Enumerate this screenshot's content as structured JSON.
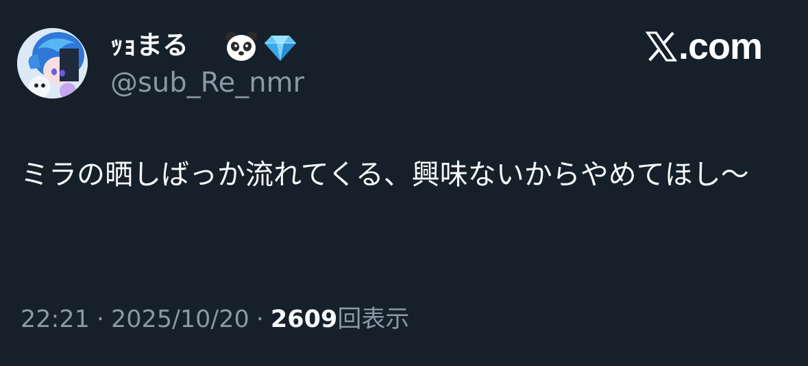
{
  "user": {
    "display_name": "ｯｮまる",
    "emojis": [
      "panda-icon",
      "gem-icon"
    ],
    "handle": "@sub_Re_nmr",
    "avatar": "anime-character-avatar"
  },
  "brand": {
    "logo": "x-logo-icon",
    "domain_text": ".com"
  },
  "tweet": {
    "text": "ミラの晒しばっか流れてくる、興味ないからやめてほし〜"
  },
  "meta": {
    "time": "22:21",
    "separator": "·",
    "date": "2025/10/20",
    "views_count": "2609",
    "views_label": "回表示"
  },
  "colors": {
    "background": "#16202b",
    "primary_text": "#f7f9f9",
    "secondary_text": "#8b98a5"
  }
}
